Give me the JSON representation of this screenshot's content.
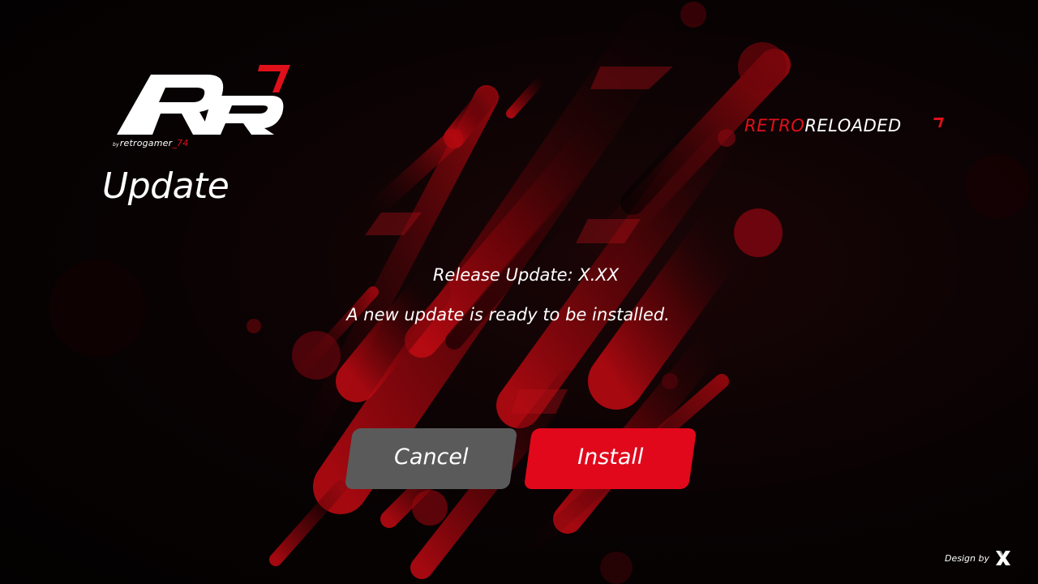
{
  "logo": {
    "byline_prefix": "by",
    "byline_name": "retrogamer",
    "byline_suffix": "_74"
  },
  "page": {
    "title": "Update"
  },
  "brand": {
    "retro": "RETRO",
    "reloaded": "RELOADED",
    "accent_color": "#e0101a"
  },
  "dialog": {
    "release_label": "Release Update: X.XX",
    "message": "A new update is ready to be installed."
  },
  "buttons": {
    "cancel_label": "Cancel",
    "install_label": "Install",
    "cancel_color": "#5a5a5a",
    "install_color": "#e1081c"
  },
  "footer": {
    "design_by": "Design by",
    "designer_icon": "x-logo-icon"
  }
}
